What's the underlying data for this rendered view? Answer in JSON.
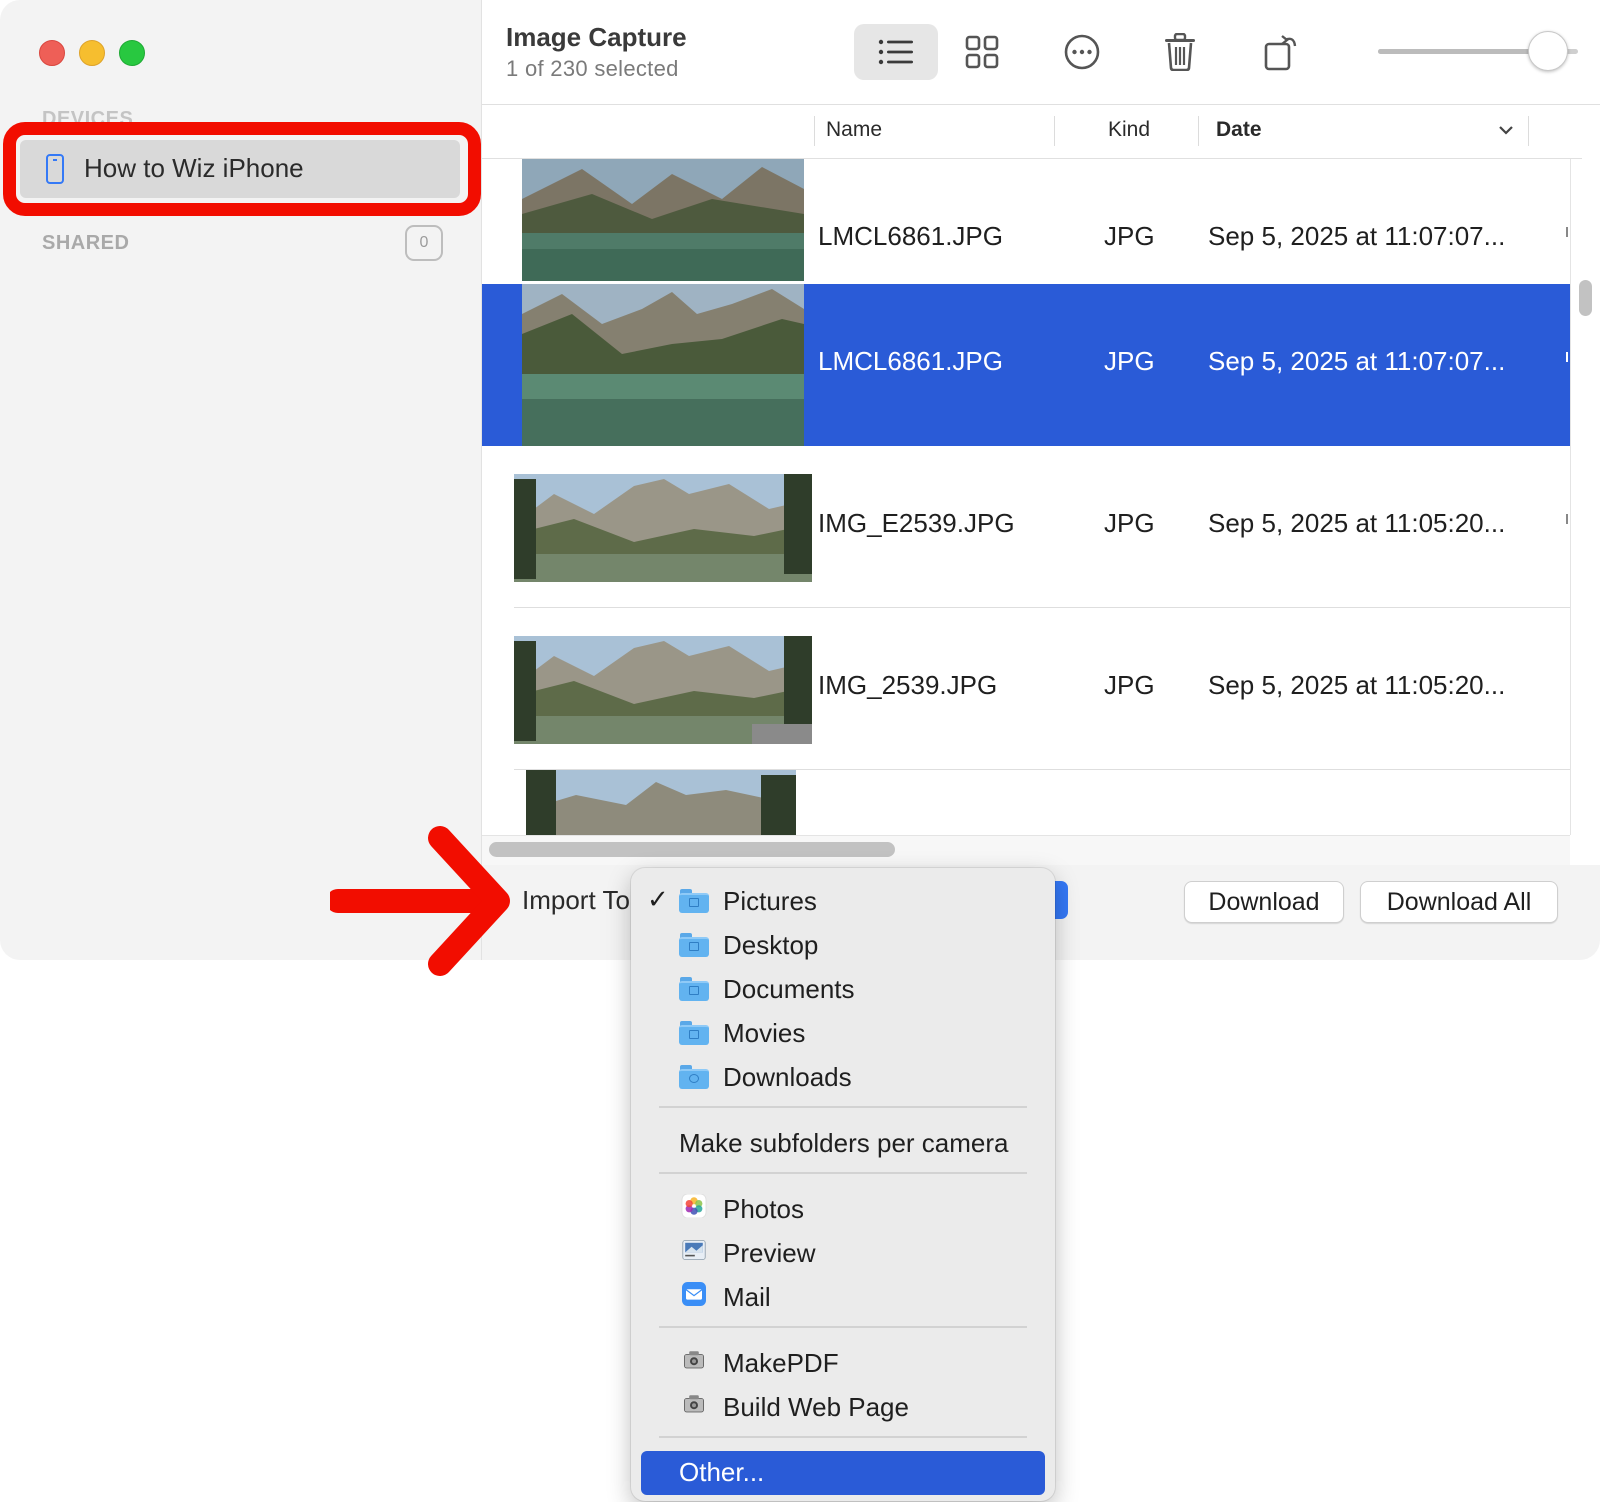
{
  "window": {
    "title": "Image Capture",
    "subtitle": "1 of 230 selected"
  },
  "sidebar": {
    "devices_header": "DEVICES",
    "device_name": "How to Wiz iPhone",
    "shared_header": "SHARED",
    "shared_count": "0"
  },
  "toolbar": {
    "list_view_icon": "list-icon",
    "grid_view_icon": "grid-icon",
    "more_icon": "ellipsis-circle-icon",
    "delete_icon": "trash-icon",
    "rotate_icon": "rotate-icon",
    "thumbnail_size": 0.85
  },
  "table": {
    "columns": [
      "Name",
      "Kind",
      "Date"
    ],
    "sorted_column": "Date",
    "rows": [
      {
        "name": "LMCL6861.JPG",
        "kind": "JPG",
        "date": "Sep 5, 2025 at 11:07:07...",
        "selected": false
      },
      {
        "name": "LMCL6861.JPG",
        "kind": "JPG",
        "date": "Sep 5, 2025 at 11:07:07...",
        "selected": true
      },
      {
        "name": "IMG_E2539.JPG",
        "kind": "JPG",
        "date": "Sep 5, 2025 at 11:05:20...",
        "selected": false
      },
      {
        "name": "IMG_2539.JPG",
        "kind": "JPG",
        "date": "Sep 5, 2025 at 11:05:20...",
        "selected": false
      }
    ]
  },
  "bottom_bar": {
    "import_label": "Import To",
    "download_label": "Download",
    "download_all_label": "Download All"
  },
  "import_menu": {
    "checked": "Pictures",
    "folders": [
      "Pictures",
      "Desktop",
      "Documents",
      "Movies",
      "Downloads"
    ],
    "subfolders_option": "Make subfolders per camera",
    "apps": [
      "Photos",
      "Preview",
      "Mail"
    ],
    "actions": [
      "MakePDF",
      "Build Web Page"
    ],
    "other": "Other..."
  },
  "colors": {
    "selection": "#2a5bd7",
    "annotation_red": "#f20d00",
    "accent_blue": "#3478f6"
  }
}
